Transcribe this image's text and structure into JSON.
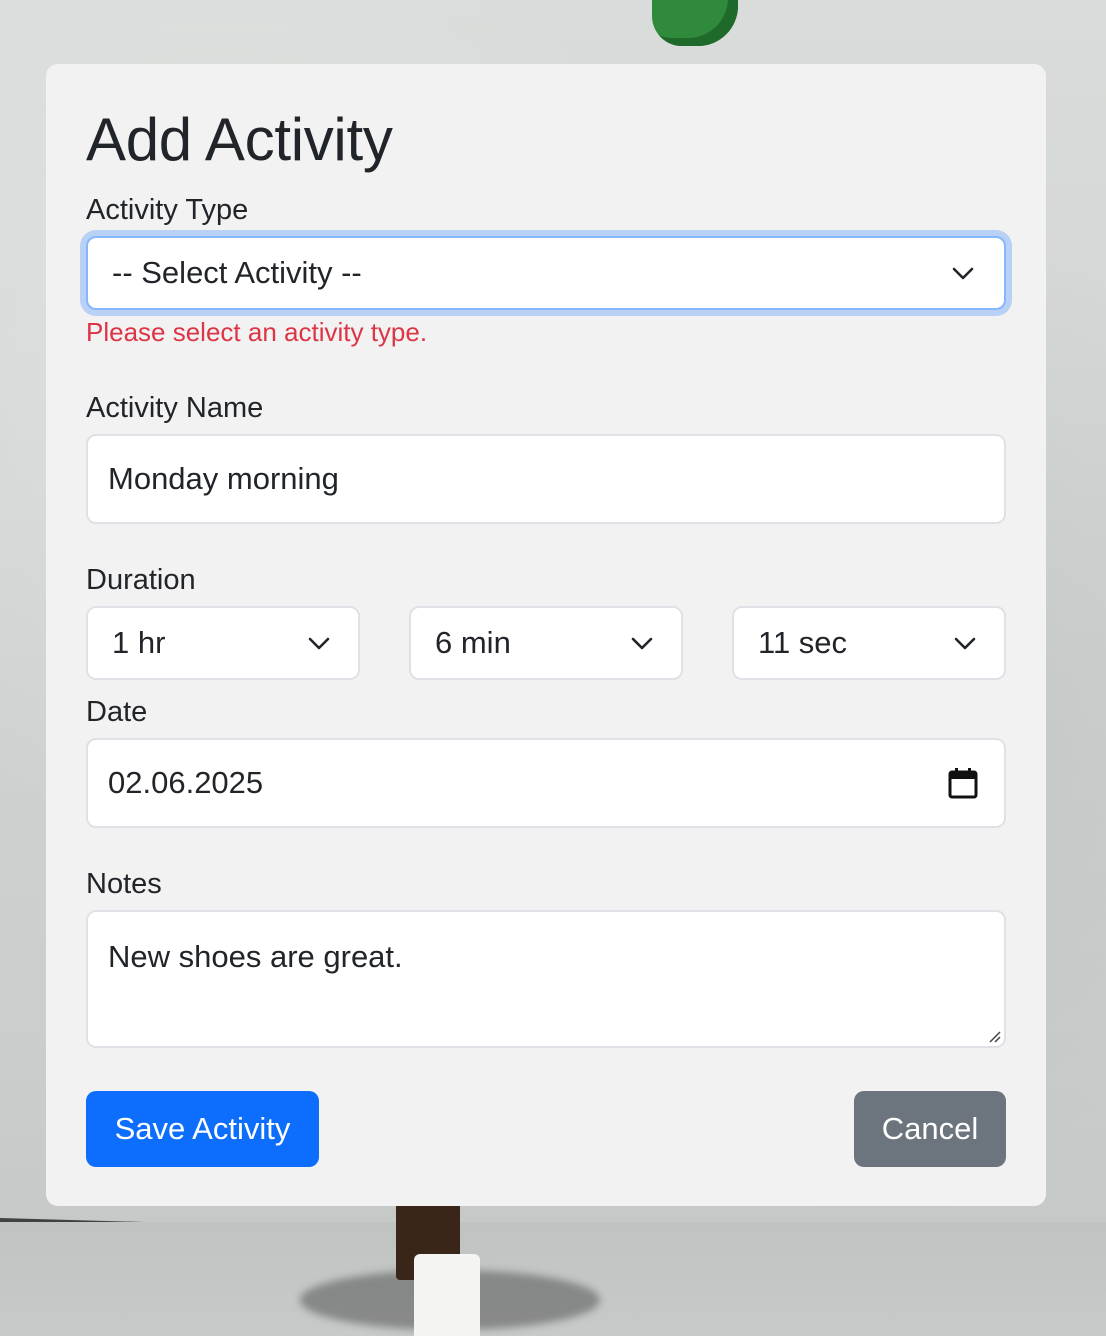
{
  "form": {
    "title": "Add Activity",
    "activity_type": {
      "label": "Activity Type",
      "selected": "-- Select Activity --",
      "error": "Please select an activity type."
    },
    "activity_name": {
      "label": "Activity Name",
      "value": "Monday morning"
    },
    "duration": {
      "label": "Duration",
      "hours": "1 hr",
      "minutes": "6 min",
      "seconds": "11 sec"
    },
    "date": {
      "label": "Date",
      "value": "02.06.2025"
    },
    "notes": {
      "label": "Notes",
      "value": "New shoes are great."
    },
    "buttons": {
      "save": "Save Activity",
      "cancel": "Cancel"
    }
  },
  "colors": {
    "primary": "#0d6efd",
    "secondary": "#6c757d",
    "error": "#dc3545",
    "focus_ring": "#86b7fe",
    "card": "#f2f2f2"
  },
  "icons": {
    "select_arrow": "chevron-down-icon",
    "date_picker": "calendar-icon",
    "textarea_resize": "resize-grip-icon"
  }
}
